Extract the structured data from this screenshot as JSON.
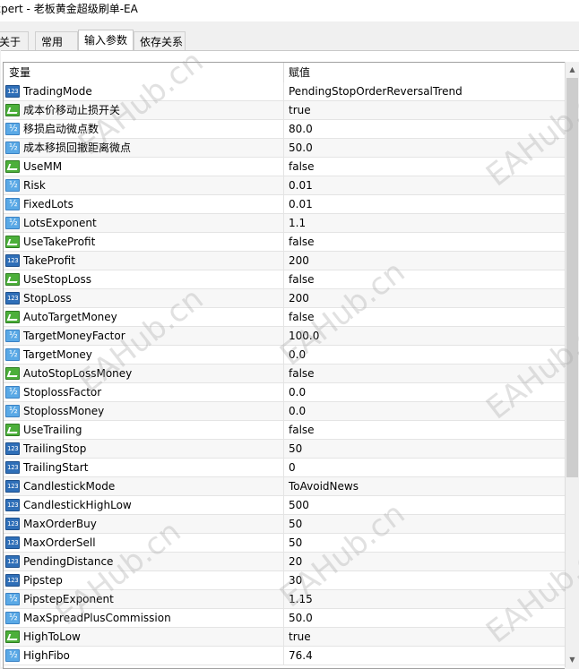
{
  "window": {
    "title": "xpert - 老板黄金超级刷单-EA"
  },
  "tabs": [
    {
      "label": "关于",
      "active": false
    },
    {
      "label": "常用",
      "active": false
    },
    {
      "label": "输入参数",
      "active": true
    },
    {
      "label": "依存关系",
      "active": false
    }
  ],
  "table": {
    "headers": {
      "variable": "变量",
      "value": "赋值"
    },
    "rows": [
      {
        "icon": "int",
        "name": "TradingMode",
        "value": "PendingStopOrderReversalTrend"
      },
      {
        "icon": "bool",
        "name": "成本价移动止损开关",
        "value": "true"
      },
      {
        "icon": "dbl",
        "name": "移损启动微点数",
        "value": "80.0"
      },
      {
        "icon": "dbl",
        "name": "成本移损回撤距离微点",
        "value": "50.0"
      },
      {
        "icon": "bool",
        "name": "UseMM",
        "value": "false"
      },
      {
        "icon": "dbl",
        "name": "Risk",
        "value": "0.01"
      },
      {
        "icon": "dbl",
        "name": "FixedLots",
        "value": "0.01"
      },
      {
        "icon": "dbl",
        "name": "LotsExponent",
        "value": "1.1"
      },
      {
        "icon": "bool",
        "name": "UseTakeProfit",
        "value": "false"
      },
      {
        "icon": "int",
        "name": "TakeProfit",
        "value": "200"
      },
      {
        "icon": "bool",
        "name": "UseStopLoss",
        "value": "false"
      },
      {
        "icon": "int",
        "name": "StopLoss",
        "value": "200"
      },
      {
        "icon": "bool",
        "name": "AutoTargetMoney",
        "value": "false"
      },
      {
        "icon": "dbl",
        "name": "TargetMoneyFactor",
        "value": "100.0"
      },
      {
        "icon": "dbl",
        "name": "TargetMoney",
        "value": "0.0"
      },
      {
        "icon": "bool",
        "name": "AutoStopLossMoney",
        "value": "false"
      },
      {
        "icon": "dbl",
        "name": "StoplossFactor",
        "value": "0.0"
      },
      {
        "icon": "dbl",
        "name": "StoplossMoney",
        "value": "0.0"
      },
      {
        "icon": "bool",
        "name": "UseTrailing",
        "value": "false"
      },
      {
        "icon": "int",
        "name": "TrailingStop",
        "value": "50"
      },
      {
        "icon": "int",
        "name": "TrailingStart",
        "value": "0"
      },
      {
        "icon": "int",
        "name": "CandlestickMode",
        "value": "ToAvoidNews"
      },
      {
        "icon": "int",
        "name": "CandlestickHighLow",
        "value": "500"
      },
      {
        "icon": "int",
        "name": "MaxOrderBuy",
        "value": "50"
      },
      {
        "icon": "int",
        "name": "MaxOrderSell",
        "value": "50"
      },
      {
        "icon": "int",
        "name": "PendingDistance",
        "value": "20"
      },
      {
        "icon": "int",
        "name": "Pipstep",
        "value": "30"
      },
      {
        "icon": "dbl",
        "name": "PipstepExponent",
        "value": "1.15"
      },
      {
        "icon": "dbl",
        "name": "MaxSpreadPlusCommission",
        "value": "50.0"
      },
      {
        "icon": "bool",
        "name": "HighToLow",
        "value": "true"
      },
      {
        "icon": "dbl",
        "name": "HighFibo",
        "value": "76.4"
      }
    ]
  },
  "watermark": {
    "text": "EAHub.cn"
  },
  "colors": {
    "int_icon": "#2f6fb8",
    "double_icon": "#5aa9e6",
    "bool_icon": "#4caf3a"
  }
}
